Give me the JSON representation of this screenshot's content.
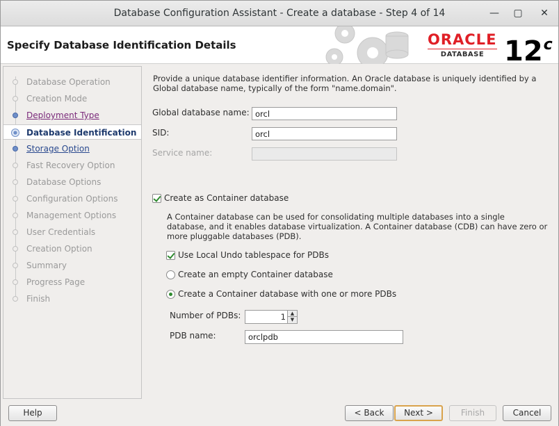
{
  "window": {
    "title": "Database Configuration Assistant - Create a database - Step 4 of 14",
    "minimize_glyph": "—",
    "maximize_glyph": "▢",
    "close_glyph": "✕"
  },
  "header": {
    "title": "Specify Database Identification Details",
    "logo_word": "ORACLE",
    "logo_sub": "DATABASE",
    "version_number": "12",
    "version_letter": "c"
  },
  "nav": {
    "items": [
      {
        "label": "Database Operation",
        "state": "disabled"
      },
      {
        "label": "Creation Mode",
        "state": "disabled"
      },
      {
        "label": "Deployment Type",
        "state": "visited"
      },
      {
        "label": "Database Identification",
        "state": "active"
      },
      {
        "label": "Storage Option",
        "state": "link"
      },
      {
        "label": "Fast Recovery Option",
        "state": "disabled"
      },
      {
        "label": "Database Options",
        "state": "disabled"
      },
      {
        "label": "Configuration Options",
        "state": "disabled"
      },
      {
        "label": "Management Options",
        "state": "disabled"
      },
      {
        "label": "User Credentials",
        "state": "disabled"
      },
      {
        "label": "Creation Option",
        "state": "disabled"
      },
      {
        "label": "Summary",
        "state": "disabled"
      },
      {
        "label": "Progress Page",
        "state": "disabled"
      },
      {
        "label": "Finish",
        "state": "disabled"
      }
    ]
  },
  "content": {
    "intro_line1": "Provide a unique database identifier information. An Oracle database is uniquely identified by a",
    "intro_line2": "Global database name, typically of the form \"name.domain\".",
    "global_db_label": "Global database name:",
    "global_db_value": "orcl",
    "sid_label": "SID:",
    "sid_value": "orcl",
    "service_label": "Service name:",
    "service_value": "",
    "container_checkbox_label": "Create as Container database",
    "container_checked": true,
    "container_desc_line1": "A Container database can be used for consolidating multiple databases into a single",
    "container_desc_line2": "database, and it enables database virtualization. A Container database (CDB) can have zero or",
    "container_desc_line3": "more pluggable databases (PDB).",
    "local_undo_label": "Use Local Undo tablespace for PDBs",
    "local_undo_checked": true,
    "empty_cdb_label": "Create an empty Container database",
    "empty_cdb_selected": false,
    "cdb_with_pdbs_label": "Create a Container database with one or more PDBs",
    "cdb_with_pdbs_selected": true,
    "num_pdbs_label": "Number of PDBs:",
    "num_pdbs_value": "1",
    "pdb_name_label": "PDB name:",
    "pdb_name_value": "orclpdb"
  },
  "buttons": {
    "help": "Help",
    "back": "< Back",
    "next": "Next >",
    "finish": "Finish",
    "cancel": "Cancel"
  },
  "colors": {
    "oracle_red": "#e01f26",
    "nav_link": "#2b4a8f",
    "nav_visited": "#7a2a7a",
    "check_green": "#2e8a2e"
  }
}
